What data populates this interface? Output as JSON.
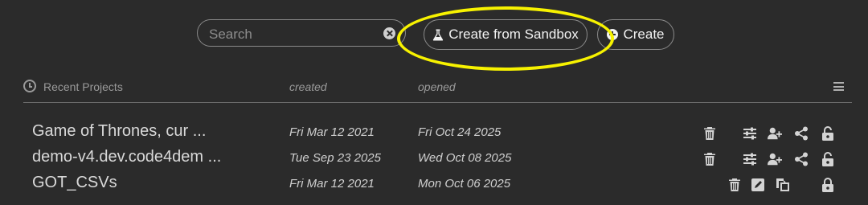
{
  "search": {
    "placeholder": "Search"
  },
  "toolbar": {
    "sandbox_label": "Create from Sandbox",
    "create_label": "Create"
  },
  "header": {
    "recent_label": "Recent Projects",
    "created_label": "created",
    "opened_label": "opened"
  },
  "projects": [
    {
      "name": "Game of Thrones, cur ...",
      "created": "Fri Mar 12 2021",
      "opened": "Fri Oct 24 2025",
      "actions": [
        "trash-icon",
        "sliders-icon",
        "add-user-icon",
        "share-icon",
        "unlock-icon"
      ]
    },
    {
      "name": "demo-v4.dev.code4dem ...",
      "created": "Tue Sep 23 2025",
      "opened": "Wed Oct 08 2025",
      "actions": [
        "trash-icon",
        "sliders-icon",
        "add-user-icon",
        "share-icon",
        "unlock-icon"
      ]
    },
    {
      "name": "GOT_CSVs",
      "created": "Fri Mar 12 2021",
      "opened": "Mon Oct 06 2025",
      "actions": [
        "trash-icon",
        "edit-icon",
        "copy-icon",
        "lock-icon"
      ]
    }
  ],
  "colors": {
    "background": "#2b2b2b",
    "highlight": "#f7f200",
    "text": "#d6d6d6"
  }
}
